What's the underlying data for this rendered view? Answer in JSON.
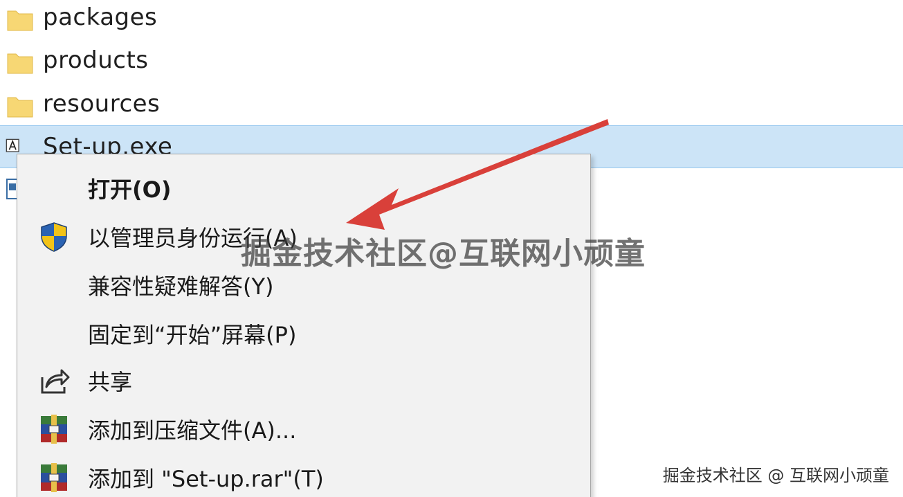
{
  "files": [
    {
      "name": "packages",
      "icon": "folder-icon"
    },
    {
      "name": "products",
      "icon": "folder-icon"
    },
    {
      "name": "resources",
      "icon": "folder-icon"
    },
    {
      "name": "Set-up.exe",
      "icon": "adobe-installer-icon",
      "selected": true
    }
  ],
  "context_menu": {
    "items": [
      {
        "label": "打开(O)",
        "bold": true,
        "icon": ""
      },
      {
        "label": "以管理员身份运行(A)",
        "icon": "uac-shield-icon"
      },
      {
        "label": "兼容性疑难解答(Y)",
        "icon": ""
      },
      {
        "label": "固定到“开始”屏幕(P)",
        "icon": ""
      },
      {
        "label": "共享",
        "icon": "share-icon"
      },
      {
        "label": "添加到压缩文件(A)...",
        "icon": "winrar-icon"
      },
      {
        "label": "添加到 \"Set-up.rar\"(T)",
        "icon": "winrar-icon"
      }
    ]
  },
  "watermark": {
    "center": "掘金技术社区@互联网小顽童",
    "corner": "掘金技术社区 @ 互联网小顽童"
  },
  "colors": {
    "selection": "#cce4f7",
    "folder": "#f7d774",
    "arrow": "#d9403a",
    "menu_bg": "#f2f2f2"
  }
}
